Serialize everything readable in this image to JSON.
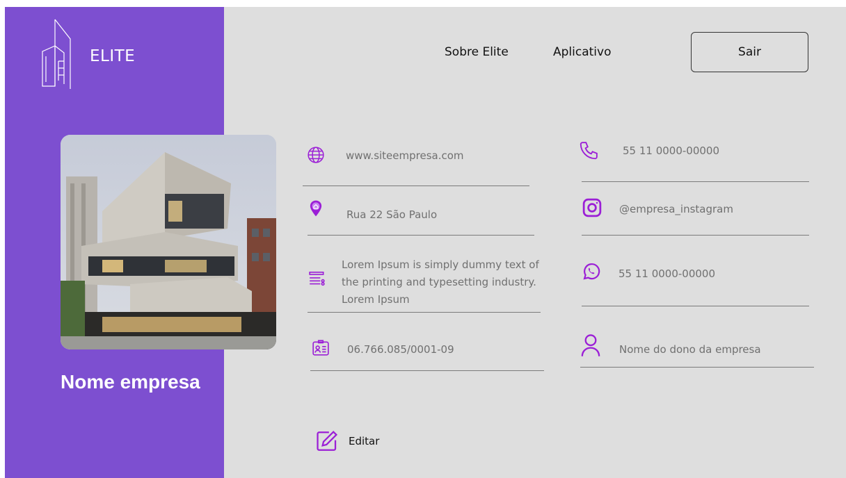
{
  "brand": {
    "name": "ELITE"
  },
  "nav": {
    "about": "Sobre Elite",
    "app": "Aplicativo",
    "logout": "Sair"
  },
  "company": {
    "name": "Nome empresa"
  },
  "fields": {
    "website": "www.siteempresa.com",
    "address": "Rua 22 São Paulo",
    "description": "Lorem Ipsum is simply dummy text of the printing and typesetting industry. Lorem Ipsum",
    "cnpj": "06.766.085/0001-09",
    "phone": "55 11 0000-00000",
    "instagram": "@empresa_instagram",
    "whatsapp": "55 11 0000-00000",
    "owner": "Nome do dono da empresa"
  },
  "actions": {
    "edit": "Editar"
  },
  "colors": {
    "accent": "#7d4fd0",
    "icon": "#9b1fd6",
    "background": "#dedede"
  },
  "icons": {
    "website": "globe-icon",
    "address": "location-pin-icon",
    "description": "description-list-icon",
    "cnpj": "id-card-icon",
    "phone": "phone-icon",
    "instagram": "instagram-icon",
    "whatsapp": "whatsapp-icon",
    "owner": "user-icon",
    "edit": "edit-icon"
  }
}
